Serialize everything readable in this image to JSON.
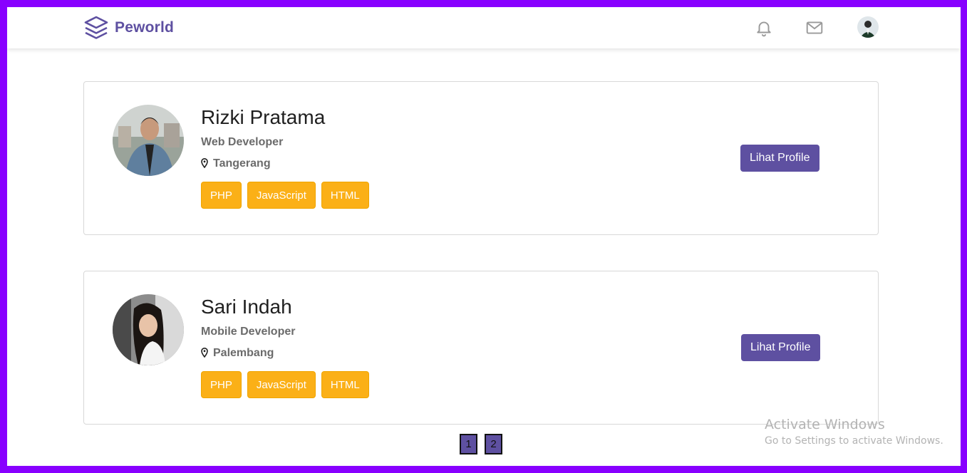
{
  "brand": {
    "name": "Peworld",
    "icon": "layers-icon"
  },
  "nav": {
    "notification_icon": "bell-icon",
    "mail_icon": "mail-icon",
    "avatar": "user-avatar"
  },
  "candidates": [
    {
      "name": "Rizki Pratama",
      "role": "Web Developer",
      "location": "Tangerang",
      "skills": [
        "PHP",
        "JavaScript",
        "HTML"
      ],
      "button": "Lihat Profile"
    },
    {
      "name": "Sari Indah",
      "role": "Mobile Developer",
      "location": "Palembang",
      "skills": [
        "PHP",
        "JavaScript",
        "HTML"
      ],
      "button": "Lihat Profile"
    }
  ],
  "pagination": {
    "pages": [
      "1",
      "2"
    ]
  },
  "watermark": {
    "title": "Activate Windows",
    "subtitle": "Go to Settings to activate Windows."
  },
  "colors": {
    "primary": "#5e50a1",
    "skill": "#fbb017",
    "frame": "#8800ff"
  }
}
